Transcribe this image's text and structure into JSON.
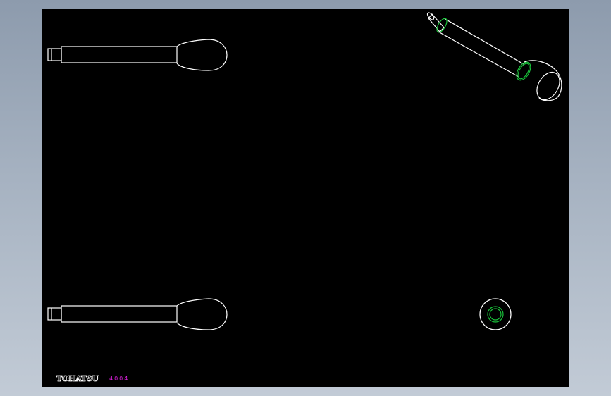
{
  "drawing": {
    "background_color": "#000000",
    "line_color": "#ffffff",
    "hidden_edge_color": "#19c23a",
    "label_brand": "TOHATSU",
    "label_code": "4004",
    "label_code_color": "#e020e0"
  }
}
